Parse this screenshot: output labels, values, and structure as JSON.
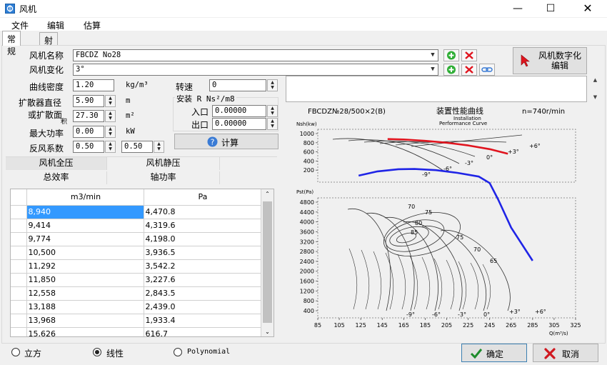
{
  "window": {
    "title": "风机"
  },
  "menu": [
    "文件",
    "编辑",
    "估算"
  ],
  "tabs": [
    "常规",
    "射流风机"
  ],
  "form": {
    "fan_name_label": "风机名称",
    "fan_name_value": "FBCDZ No28",
    "fan_change_label": "风机变化",
    "fan_change_value": "3°",
    "curve_density_label": "曲线密度",
    "curve_density_value": "1.20",
    "curve_density_unit": "kg/m³",
    "speed_label": "转速",
    "speed_value": "0",
    "diffuser_label": "扩散器直径",
    "diffuser_value": "5.90",
    "diffuser_unit": "m",
    "diffuser_area_label1": "或扩散面",
    "diffuser_area_label2": "积",
    "diffuser_area_value": "27.30",
    "diffuser_area_unit": "m²",
    "max_power_label": "最大功率",
    "max_power_value": "0.00",
    "max_power_unit": "kW",
    "backflow_label": "反风系数",
    "backflow_value1": "0.50",
    "backflow_value2": "0.50",
    "install_label": "安装 R Ns²/m8",
    "inlet_label": "入口",
    "inlet_value": "0.00000",
    "outlet_label": "出口",
    "outlet_value": "0.00000",
    "calc_button": "计算",
    "fan_edit_button": "风机数字化编辑"
  },
  "section_tabs": {
    "row1": [
      "风机全压",
      "风机静压"
    ],
    "row2": [
      "总效率",
      "轴功率"
    ]
  },
  "table": {
    "headers": [
      "m3/min",
      "Pa"
    ],
    "rows": [
      [
        "8,940",
        "4,470.8"
      ],
      [
        "9,414",
        "4,319.6"
      ],
      [
        "9,774",
        "4,198.0"
      ],
      [
        "10,500",
        "3,936.5"
      ],
      [
        "11,292",
        "3,542.2"
      ],
      [
        "11,850",
        "3,227.6"
      ],
      [
        "12,558",
        "2,843.5"
      ],
      [
        "13,188",
        "2,439.0"
      ],
      [
        "13,968",
        "1,933.4"
      ],
      [
        "15,626",
        "616.7"
      ]
    ]
  },
  "radio": [
    "立方",
    "线性",
    "Polynomial"
  ],
  "radio_selected": 1,
  "buttons": {
    "ok": "确定",
    "cancel": "取消"
  },
  "chart_data": {
    "type": "line",
    "title": "FBCDZ№28/500×2(B)",
    "title2": "装置性能曲线",
    "title3": "n=740r/min",
    "title_en1": "Installation",
    "title_en2": "Performance Curve",
    "top_ylabel": "Nsh(kw)",
    "bottom_ylabel": "Pst(Pa)",
    "xlabel": "Q(m³/s)",
    "top_yticks": [
      1000,
      800,
      600,
      400,
      200
    ],
    "bottom_yticks": [
      4800,
      4400,
      4000,
      3600,
      3200,
      2800,
      2400,
      2000,
      1600,
      1200,
      800,
      400
    ],
    "x_ticks": [
      85,
      105,
      125,
      145,
      165,
      185,
      205,
      225,
      245,
      265,
      285,
      305,
      325
    ],
    "angle_labels_top": [
      "-9°",
      "-6°",
      "-3°",
      "0°",
      "+3°",
      "+6°"
    ],
    "angle_labels_bottom": [
      "-9°",
      "-6°",
      "-3°",
      "0°",
      "+3°",
      "+6°"
    ],
    "efficiency_labels": [
      "70",
      "75",
      "80",
      "85",
      "75",
      "70",
      "65"
    ],
    "series": [
      {
        "color": "#e0141e",
        "x": [
          150,
          165,
          185,
          205,
          225,
          245,
          262
        ],
        "y": [
          880,
          870,
          840,
          800,
          740,
          660,
          560
        ]
      },
      {
        "color": "#1f24e6",
        "x": [
          123,
          140,
          160,
          175,
          195,
          215,
          235,
          245,
          253,
          265,
          285
        ],
        "y": [
          80,
          170,
          220,
          225,
          200,
          140,
          60,
          -300,
          -1600,
          -3800,
          -6400
        ]
      }
    ]
  }
}
